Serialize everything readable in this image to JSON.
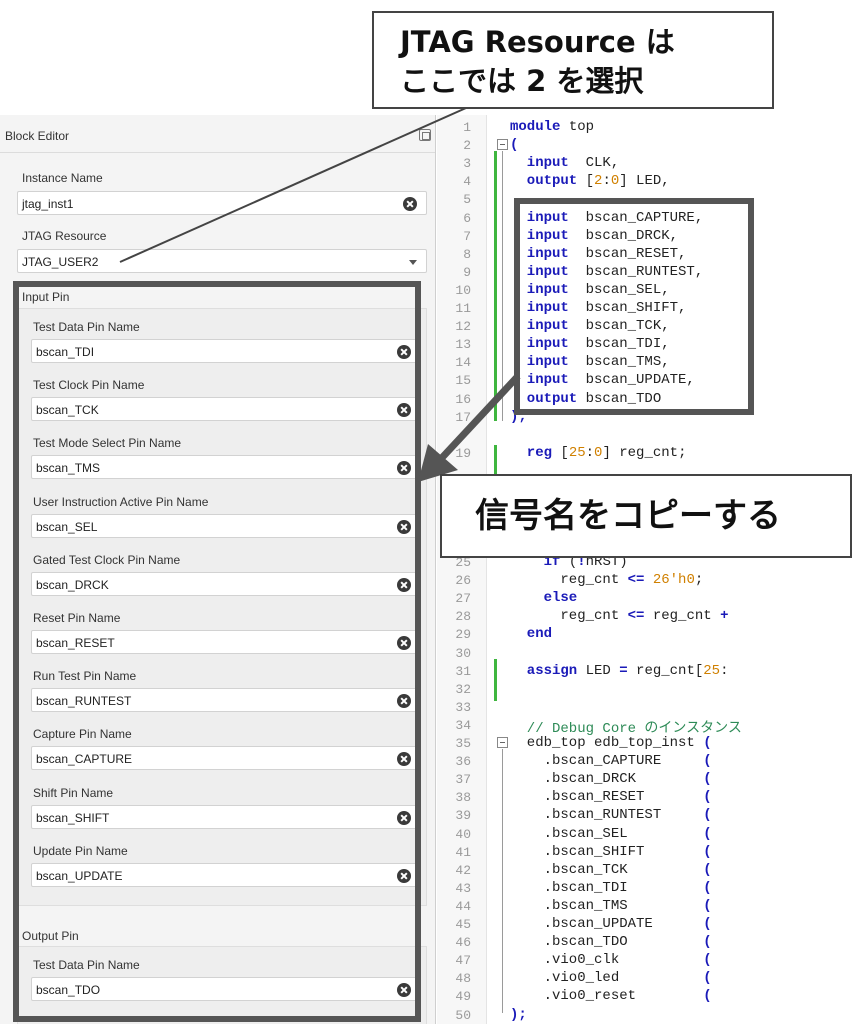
{
  "callouts": {
    "jtag_line1": "JTAG Resource は",
    "jtag_line2": "ここでは 2 を選択",
    "copy": "信号名をコピーする"
  },
  "block_editor": {
    "title": "Block Editor",
    "instance_label": "Instance Name",
    "instance_value": "jtag_inst1",
    "resource_label": "JTAG Resource",
    "resource_value": "JTAG_USER2",
    "input_group": "Input Pin",
    "input_pins": [
      {
        "label": "Test Data Pin Name",
        "value": "bscan_TDI"
      },
      {
        "label": "Test Clock Pin Name",
        "value": "bscan_TCK"
      },
      {
        "label": "Test Mode Select Pin Name",
        "value": "bscan_TMS"
      },
      {
        "label": "User Instruction Active Pin Name",
        "value": "bscan_SEL"
      },
      {
        "label": "Gated Test Clock Pin Name",
        "value": "bscan_DRCK"
      },
      {
        "label": "Reset Pin Name",
        "value": "bscan_RESET"
      },
      {
        "label": "Run Test Pin Name",
        "value": "bscan_RUNTEST"
      },
      {
        "label": "Capture Pin Name",
        "value": "bscan_CAPTURE"
      },
      {
        "label": "Shift Pin Name",
        "value": "bscan_SHIFT"
      },
      {
        "label": "Update Pin Name",
        "value": "bscan_UPDATE"
      }
    ],
    "output_group": "Output Pin",
    "output_pins": [
      {
        "label": "Test Data Pin Name",
        "value": "bscan_TDO"
      }
    ]
  },
  "code": {
    "line_numbers": [
      "1",
      "2",
      "3",
      "4",
      "5",
      "6",
      "7",
      "8",
      "9",
      "10",
      "11",
      "12",
      "13",
      "14",
      "15",
      "16",
      "17",
      "19",
      "25",
      "26",
      "27",
      "28",
      "29",
      "30",
      "31",
      "32",
      "33",
      "34",
      "35",
      "36",
      "37",
      "38",
      "39",
      "40",
      "41",
      "42",
      "43",
      "44",
      "45",
      "46",
      "47",
      "48",
      "49",
      "50"
    ],
    "lines": [
      {
        "ln": "1",
        "parts": [
          {
            "t": "module",
            "c": "kw"
          },
          {
            "t": " top",
            "c": ""
          }
        ]
      },
      {
        "ln": "2",
        "parts": [
          {
            "t": "(",
            "c": "kw"
          }
        ]
      },
      {
        "ln": "3",
        "parts": [
          {
            "t": "  input",
            "c": "kw"
          },
          {
            "t": "  CLK,",
            "c": ""
          }
        ]
      },
      {
        "ln": "4",
        "parts": [
          {
            "t": "  output",
            "c": "kw"
          },
          {
            "t": " [",
            "c": ""
          },
          {
            "t": "2",
            "c": "num"
          },
          {
            "t": ":",
            "c": ""
          },
          {
            "t": "0",
            "c": "num"
          },
          {
            "t": "] LED,",
            "c": ""
          }
        ]
      },
      {
        "ln": "5",
        "parts": []
      },
      {
        "ln": "6",
        "parts": [
          {
            "t": "  input",
            "c": "kw"
          },
          {
            "t": "  bscan_CAPTURE,",
            "c": ""
          }
        ]
      },
      {
        "ln": "7",
        "parts": [
          {
            "t": "  input",
            "c": "kw"
          },
          {
            "t": "  bscan_DRCK,",
            "c": ""
          }
        ]
      },
      {
        "ln": "8",
        "parts": [
          {
            "t": "  input",
            "c": "kw"
          },
          {
            "t": "  bscan_RESET,",
            "c": ""
          }
        ]
      },
      {
        "ln": "9",
        "parts": [
          {
            "t": "  input",
            "c": "kw"
          },
          {
            "t": "  bscan_RUNTEST,",
            "c": ""
          }
        ]
      },
      {
        "ln": "10",
        "parts": [
          {
            "t": "  input",
            "c": "kw"
          },
          {
            "t": "  bscan_SEL,",
            "c": ""
          }
        ]
      },
      {
        "ln": "11",
        "parts": [
          {
            "t": "  input",
            "c": "kw"
          },
          {
            "t": "  bscan_SHIFT,",
            "c": ""
          }
        ]
      },
      {
        "ln": "12",
        "parts": [
          {
            "t": "  input",
            "c": "kw"
          },
          {
            "t": "  bscan_TCK,",
            "c": ""
          }
        ]
      },
      {
        "ln": "13",
        "parts": [
          {
            "t": "  input",
            "c": "kw"
          },
          {
            "t": "  bscan_TDI,",
            "c": ""
          }
        ]
      },
      {
        "ln": "14",
        "parts": [
          {
            "t": "  input",
            "c": "kw"
          },
          {
            "t": "  bscan_TMS,",
            "c": ""
          }
        ]
      },
      {
        "ln": "15",
        "parts": [
          {
            "t": "  input",
            "c": "kw"
          },
          {
            "t": "  bscan_UPDATE,",
            "c": ""
          }
        ]
      },
      {
        "ln": "16",
        "parts": [
          {
            "t": "  output",
            "c": "kw"
          },
          {
            "t": " bscan_TDO",
            "c": ""
          }
        ]
      },
      {
        "ln": "17",
        "parts": [
          {
            "t": ");",
            "c": "kw"
          }
        ]
      },
      {
        "ln": "19",
        "parts": [
          {
            "t": "  reg",
            "c": "kw"
          },
          {
            "t": " [",
            "c": ""
          },
          {
            "t": "25",
            "c": "num"
          },
          {
            "t": ":",
            "c": ""
          },
          {
            "t": "0",
            "c": "num"
          },
          {
            "t": "] reg_cnt;",
            "c": ""
          }
        ]
      },
      {
        "ln": "25",
        "parts": [
          {
            "t": "    if",
            "c": "kw"
          },
          {
            "t": " (",
            "c": ""
          },
          {
            "t": "!",
            "c": "op"
          },
          {
            "t": "nRST)",
            "c": ""
          }
        ]
      },
      {
        "ln": "26",
        "parts": [
          {
            "t": "      reg_cnt ",
            "c": ""
          },
          {
            "t": "<=",
            "c": "op"
          },
          {
            "t": " ",
            "c": ""
          },
          {
            "t": "26'h0",
            "c": "num"
          },
          {
            "t": ";",
            "c": ""
          }
        ]
      },
      {
        "ln": "27",
        "parts": [
          {
            "t": "    else",
            "c": "kw"
          }
        ]
      },
      {
        "ln": "28",
        "parts": [
          {
            "t": "      reg_cnt ",
            "c": ""
          },
          {
            "t": "<=",
            "c": "op"
          },
          {
            "t": " reg_cnt ",
            "c": ""
          },
          {
            "t": "+",
            "c": "op"
          }
        ]
      },
      {
        "ln": "29",
        "parts": [
          {
            "t": "  end",
            "c": "kw"
          }
        ]
      },
      {
        "ln": "30",
        "parts": []
      },
      {
        "ln": "31",
        "parts": [
          {
            "t": "  assign",
            "c": "kw"
          },
          {
            "t": " LED ",
            "c": ""
          },
          {
            "t": "=",
            "c": "op"
          },
          {
            "t": " reg_cnt[",
            "c": ""
          },
          {
            "t": "25",
            "c": "num"
          },
          {
            "t": ":",
            "c": ""
          }
        ]
      },
      {
        "ln": "32",
        "parts": []
      },
      {
        "ln": "33",
        "parts": []
      },
      {
        "ln": "34",
        "parts": [
          {
            "t": "  // Debug Core のインスタンス",
            "c": "cmt"
          }
        ]
      },
      {
        "ln": "35",
        "parts": [
          {
            "t": "  edb_top edb_top_inst ",
            "c": ""
          },
          {
            "t": "(",
            "c": "kw"
          }
        ]
      },
      {
        "ln": "36",
        "parts": [
          {
            "t": "    .bscan_CAPTURE     ",
            "c": ""
          },
          {
            "t": "(",
            "c": "kw"
          }
        ]
      },
      {
        "ln": "37",
        "parts": [
          {
            "t": "    .bscan_DRCK        ",
            "c": ""
          },
          {
            "t": "(",
            "c": "kw"
          }
        ]
      },
      {
        "ln": "38",
        "parts": [
          {
            "t": "    .bscan_RESET       ",
            "c": ""
          },
          {
            "t": "(",
            "c": "kw"
          }
        ]
      },
      {
        "ln": "39",
        "parts": [
          {
            "t": "    .bscan_RUNTEST     ",
            "c": ""
          },
          {
            "t": "(",
            "c": "kw"
          }
        ]
      },
      {
        "ln": "40",
        "parts": [
          {
            "t": "    .bscan_SEL         ",
            "c": ""
          },
          {
            "t": "(",
            "c": "kw"
          }
        ]
      },
      {
        "ln": "41",
        "parts": [
          {
            "t": "    .bscan_SHIFT       ",
            "c": ""
          },
          {
            "t": "(",
            "c": "kw"
          }
        ]
      },
      {
        "ln": "42",
        "parts": [
          {
            "t": "    .bscan_TCK         ",
            "c": ""
          },
          {
            "t": "(",
            "c": "kw"
          }
        ]
      },
      {
        "ln": "43",
        "parts": [
          {
            "t": "    .bscan_TDI         ",
            "c": ""
          },
          {
            "t": "(",
            "c": "kw"
          }
        ]
      },
      {
        "ln": "44",
        "parts": [
          {
            "t": "    .bscan_TMS         ",
            "c": ""
          },
          {
            "t": "(",
            "c": "kw"
          }
        ]
      },
      {
        "ln": "45",
        "parts": [
          {
            "t": "    .bscan_UPDATE      ",
            "c": ""
          },
          {
            "t": "(",
            "c": "kw"
          }
        ]
      },
      {
        "ln": "46",
        "parts": [
          {
            "t": "    .bscan_TDO         ",
            "c": ""
          },
          {
            "t": "(",
            "c": "kw"
          }
        ]
      },
      {
        "ln": "47",
        "parts": [
          {
            "t": "    .vio0_clk          ",
            "c": ""
          },
          {
            "t": "(",
            "c": "kw"
          }
        ]
      },
      {
        "ln": "48",
        "parts": [
          {
            "t": "    .vio0_led          ",
            "c": ""
          },
          {
            "t": "(",
            "c": "kw"
          }
        ]
      },
      {
        "ln": "49",
        "parts": [
          {
            "t": "    .vio0_reset        ",
            "c": ""
          },
          {
            "t": "(",
            "c": "kw"
          }
        ]
      },
      {
        "ln": "50",
        "parts": [
          {
            "t": ");",
            "c": "kw"
          }
        ]
      }
    ]
  },
  "icons": {
    "clear": "clear-circle-x-icon",
    "dropdown": "chevron-down-icon",
    "detach": "detach-panel-icon",
    "fold": "fold-minus-icon"
  }
}
